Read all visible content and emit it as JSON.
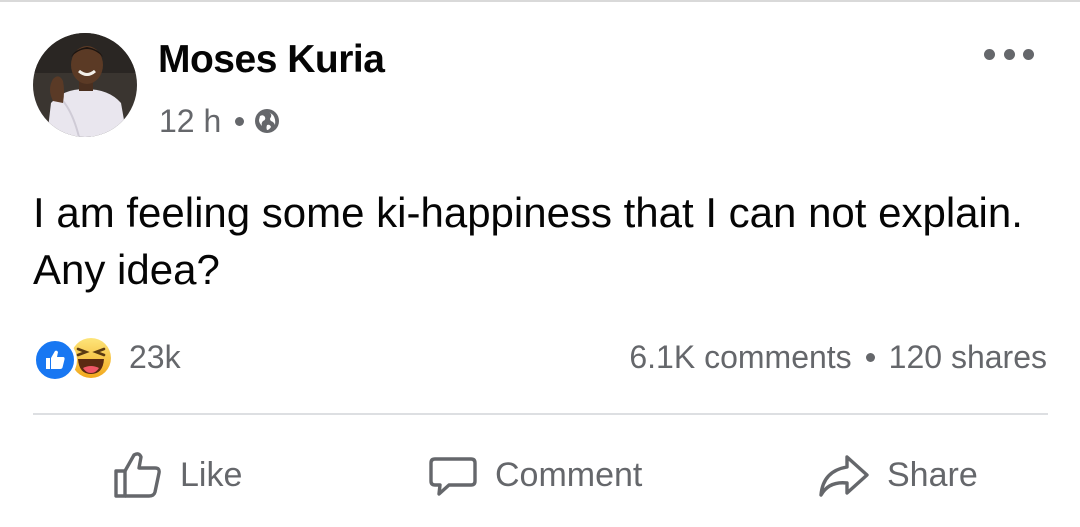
{
  "post": {
    "author": "Moses Kuria",
    "time": "12 h",
    "privacy_icon": "globe-icon",
    "text": "I am feeling some ki-happiness that I can not explain. Any idea?"
  },
  "stats": {
    "reaction_icons": [
      "like-icon",
      "haha-icon"
    ],
    "reaction_count": "23k",
    "comments": "6.1K comments",
    "shares": "120 shares"
  },
  "actions": {
    "like_label": "Like",
    "comment_label": "Comment",
    "share_label": "Share"
  },
  "colors": {
    "like_blue": "#1877f2",
    "haha_yellow": "#f7b125",
    "secondary_text": "#65676b",
    "primary_text": "#050505"
  }
}
